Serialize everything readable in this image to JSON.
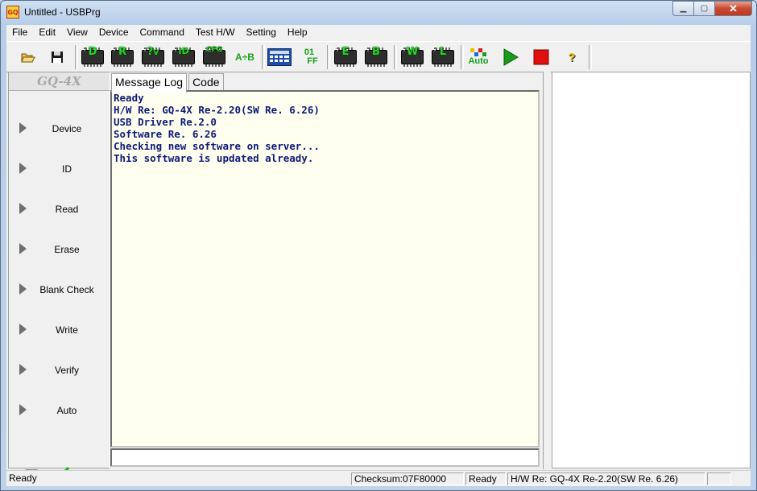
{
  "window": {
    "title": "Untitled - USBPrg",
    "icon": "gq-app-icon",
    "controls": {
      "minimize": "minimize-icon",
      "maximize": "maximize-icon",
      "close": "close-icon"
    }
  },
  "menu": [
    "File",
    "Edit",
    "View",
    "Device",
    "Command",
    "Test H/W",
    "Setting",
    "Help"
  ],
  "toolbar": {
    "chip_d": "D",
    "chip_r": "R",
    "chip_v": "?",
    "chip_v_sub": "V",
    "chip_id": "ID",
    "chip_cfg": "CFG",
    "ab_compare": "A÷B",
    "hex_01": "01",
    "hex_ff": "FF",
    "chip_e": "E",
    "chip_b": "B",
    "chip_w": "W",
    "chip_l": "L",
    "auto": "Auto",
    "help": "?",
    "colors": {
      "chip_green": "#2bd42b",
      "play_green": "#1a9b1a",
      "stop_red": "#e01010",
      "help_yellow": "#e8c000"
    }
  },
  "sidebar": {
    "brand": "GQ-4X",
    "items": [
      "Device",
      "ID",
      "Read",
      "Erase",
      "Blank Check",
      "Write",
      "Verify",
      "Auto"
    ]
  },
  "tabs": [
    "Message Log",
    "Code"
  ],
  "log": [
    "Ready",
    "H/W Re: GQ-4X Re-2.20(SW Re. 6.26)",
    "USB Driver Re.2.0",
    "Software Re. 6.26",
    "Checking new software on server...",
    "This software is updated already."
  ],
  "command_input": {
    "value": ""
  },
  "statusbar": {
    "left": "Ready",
    "checksum": "Checksum:07F80000",
    "state": "Ready",
    "hw": "H/W Re: GQ-4X Re-2.20(SW Re. 6.26)"
  },
  "colors": {
    "log_text": "#0f1a7a",
    "log_bg": "#fffff0"
  }
}
